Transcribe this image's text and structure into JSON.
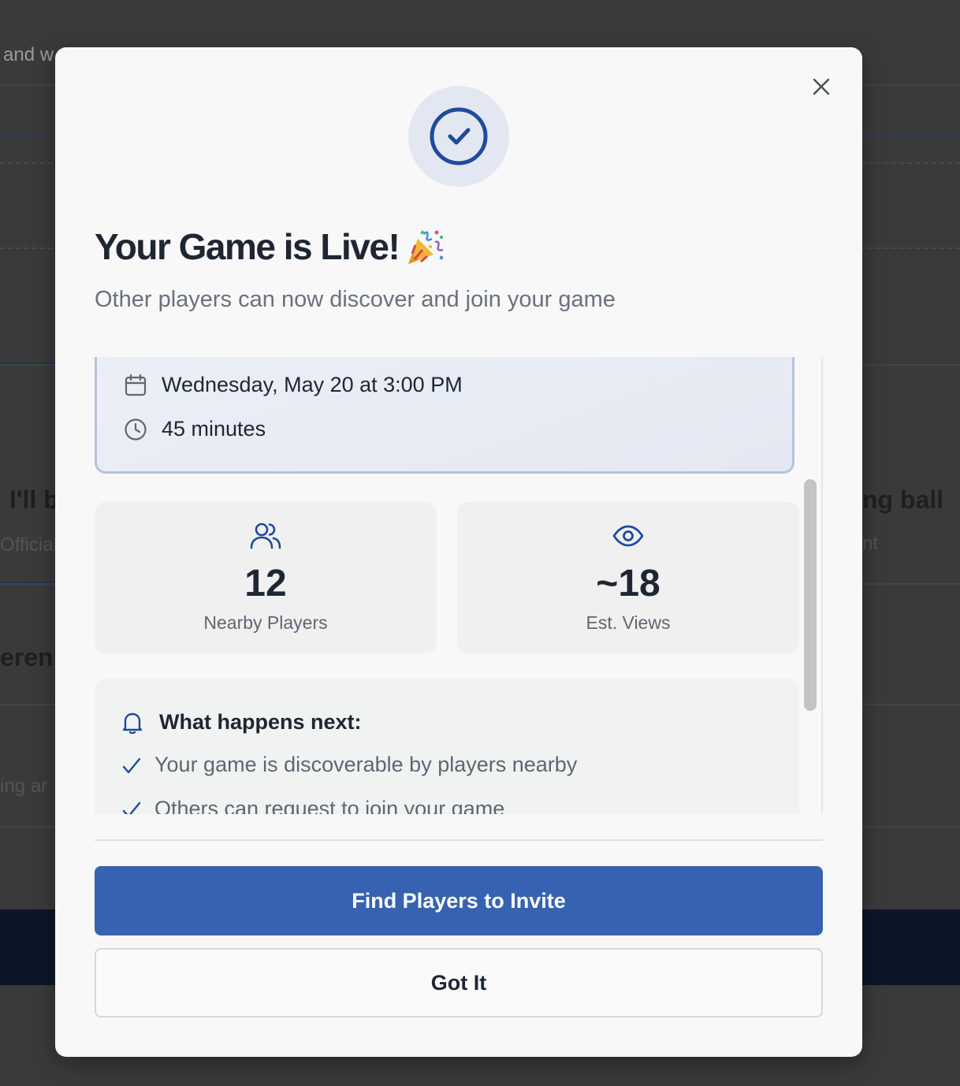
{
  "background": {
    "fragments": [
      "and w",
      "I'll b",
      "Official",
      "eren",
      "ing ar",
      "ng ball",
      "nt"
    ]
  },
  "modal": {
    "title": "Your Game is Live!",
    "title_emoji_icon": "party-popper-icon",
    "subtitle": "Other players can now discover and join your game",
    "schedule": {
      "date_text": "Wednesday, May 20 at 3:00 PM",
      "duration_text": "45 minutes"
    },
    "stats": [
      {
        "icon": "users-icon",
        "value": "12",
        "label": "Nearby Players"
      },
      {
        "icon": "eye-icon",
        "value": "~18",
        "label": "Est. Views"
      }
    ],
    "next_steps": {
      "heading": "What happens next:",
      "items": [
        "Your game is discoverable by players nearby",
        "Others can request to join your game"
      ]
    },
    "primary_button": "Find Players to Invite",
    "secondary_button": "Got It"
  },
  "colors": {
    "accent": "#3762b1",
    "accent_dark": "#1f4a9e",
    "title": "#1f2633",
    "muted": "#6a717c"
  }
}
